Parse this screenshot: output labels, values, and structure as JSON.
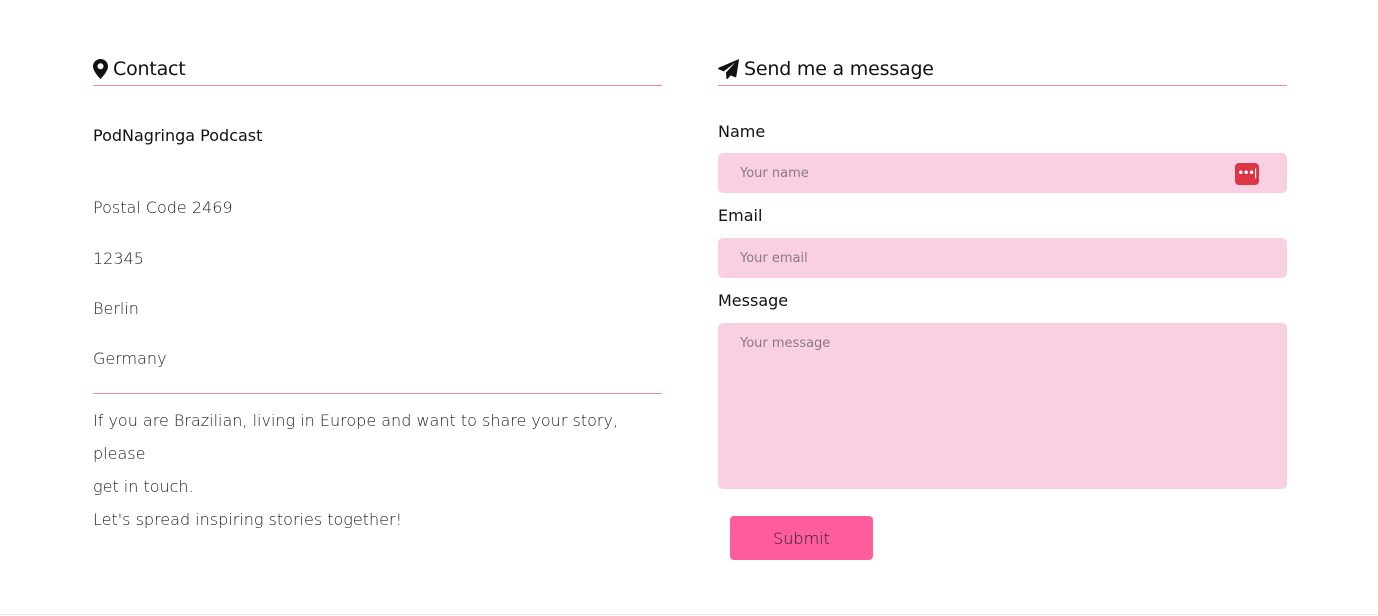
{
  "contact": {
    "heading": "Contact",
    "icon": "map-marker-icon",
    "organization": "PodNagringa Podcast",
    "address_lines": [
      "Postal Code 2469",
      "12345",
      "Berlin",
      "Germany"
    ],
    "note_lines": [
      "If you are Brazilian, living in Europe and want to share your story, please",
      "get in touch.",
      "Let's spread inspiring stories together!"
    ]
  },
  "form": {
    "heading": "Send me a message",
    "icon": "paper-plane-icon",
    "name_label": "Name",
    "name_placeholder": "Your name",
    "email_label": "Email",
    "email_placeholder": "Your email",
    "message_label": "Message",
    "message_placeholder": "Your message",
    "password_manager_icon": "password-manager-icon",
    "password_manager_glyph": "•••|",
    "submit_label": "Submit"
  },
  "colors": {
    "accent_line": "#f08aa8",
    "field_background": "#f9d0e2",
    "submit_background": "#ff5c9b",
    "password_icon_background": "#dc3545"
  }
}
